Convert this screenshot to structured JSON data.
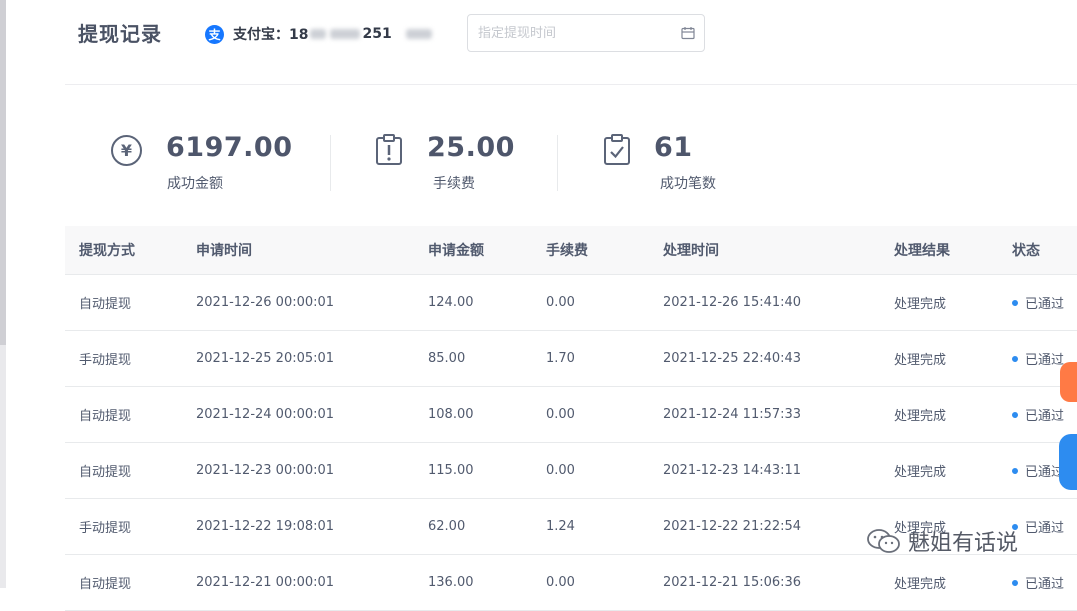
{
  "page": {
    "title": "提现记录"
  },
  "account": {
    "label": "支付宝：18",
    "suffix": "251"
  },
  "date_filter": {
    "placeholder": "指定提现时间",
    "icon": "calendar-icon"
  },
  "stats": [
    {
      "icon": "yen-icon",
      "value": "6197.00",
      "label": "成功金额"
    },
    {
      "icon": "alert-clipboard-icon",
      "value": "25.00",
      "label": "手续费"
    },
    {
      "icon": "check-clipboard-icon",
      "value": "61",
      "label": "成功笔数"
    }
  ],
  "table": {
    "columns": [
      "提现方式",
      "申请时间",
      "申请金额",
      "手续费",
      "处理时间",
      "处理结果",
      "状态"
    ],
    "rows": [
      [
        "自动提现",
        "2021-12-26 00:00:01",
        "124.00",
        "0.00",
        "2021-12-26 15:41:40",
        "处理完成",
        "已通过"
      ],
      [
        "手动提现",
        "2021-12-25 20:05:01",
        "85.00",
        "1.70",
        "2021-12-25 22:40:43",
        "处理完成",
        "已通过"
      ],
      [
        "自动提现",
        "2021-12-24 00:00:01",
        "108.00",
        "0.00",
        "2021-12-24 11:57:33",
        "处理完成",
        "已通过"
      ],
      [
        "自动提现",
        "2021-12-23 00:00:01",
        "115.00",
        "0.00",
        "2021-12-23 14:43:11",
        "处理完成",
        "已通过"
      ],
      [
        "手动提现",
        "2021-12-22 19:08:01",
        "62.00",
        "1.24",
        "2021-12-22 21:22:54",
        "处理完成",
        "已通过"
      ],
      [
        "自动提现",
        "2021-12-21 00:00:01",
        "136.00",
        "0.00",
        "2021-12-21 15:06:36",
        "处理完成",
        "已通过"
      ]
    ]
  },
  "watermark": {
    "text": "魅姐有话说"
  },
  "colors": {
    "accent": "#2d8cf0",
    "alipay": "#1677ff"
  }
}
